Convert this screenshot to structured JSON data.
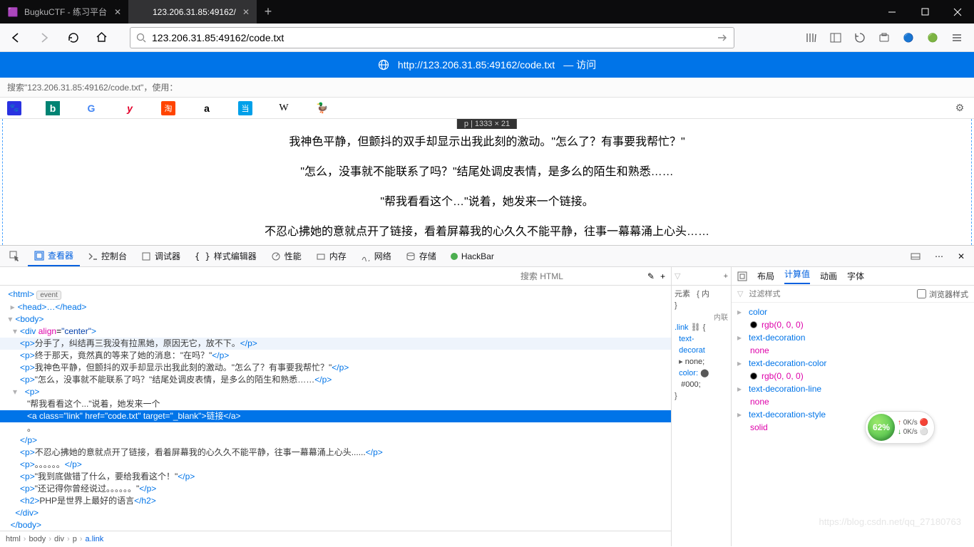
{
  "titlebar": {
    "tab1": "BugkuCTF - 练习平台",
    "tab2": "123.206.31.85:49162/"
  },
  "urlbar": {
    "value": "123.206.31.85:49162/code.txt"
  },
  "visitbar": {
    "url": "http://123.206.31.85:49162/code.txt",
    "action": "— 访问"
  },
  "searchrow": {
    "text": "搜索\"123.206.31.85:49162/code.txt\"，使用："
  },
  "engines": {
    "baidu": "百",
    "bing": "b",
    "google": "G",
    "yahoo": "y",
    "taobao": "淘",
    "amazon": "a",
    "dangdang": "当",
    "wiki": "W",
    "ddg": "●"
  },
  "content": {
    "badge": "p | 1333 × 21",
    "p1": "我神色平静，但颤抖的双手却显示出我此刻的激动。\"怎么了？有事要我帮忙？\"",
    "p2": "\"怎么，没事就不能联系了吗？\"结尾处调皮表情，是多么的陌生和熟悉……",
    "p3": "\"帮我看看这个…\"说着，她发来一个链接。",
    "p4": "不忍心拂她的意就点开了链接，看着屏幕我的心久久不能平静，往事一幕幕涌上心头……"
  },
  "devtabs": {
    "inspector": "查看器",
    "console": "控制台",
    "debugger": "调试器",
    "style": "样式编辑器",
    "perf": "性能",
    "memory": "内存",
    "network": "网络",
    "storage": "存储",
    "hackbar": "HackBar"
  },
  "htmlsearch": {
    "placeholder": "搜索 HTML"
  },
  "tree": {
    "l1": "<html>",
    "event": "event",
    "l2": "<head>…</head>",
    "l3": "<body>",
    "l4_open": "<div ",
    "l4_attr": "align",
    "l4_val": "\"center\"",
    "l4_close": ">",
    "l5_open": "<p>",
    "l5_txt": "分手了，纠结再三我没有拉黑她，原因无它，放不下。",
    "l5_close": "</p>",
    "l6_open": "<p>",
    "l6_txt": "终于那天，竟然真的等来了她的消息：\"在吗？\"",
    "l6_close": "</p>",
    "l7_open": "<p>",
    "l7_txt": "我神色平静，但颤抖的双手却显示出我此刻的激动。\"怎么了？有事要我帮忙？\"",
    "l7_close": "</p>",
    "l8_open": "<p>",
    "l8_txt": "\"怎么，没事就不能联系了吗？\"结尾处调皮表情，是多么的陌生和熟悉……",
    "l8_close": "</p>",
    "l9_open": "<p>",
    "l10_txt": "\"帮我看看这个...\"说着，她发来一个",
    "sel_open": "<a ",
    "sel_a1": "class",
    "sel_v1": "\"link\"",
    "sel_a2": "href",
    "sel_v2": "\"code.txt\"",
    "sel_a3": "target",
    "sel_v3": "\"_blank\"",
    "sel_mid": ">",
    "sel_txt": "链接",
    "sel_close": "</a>",
    "l12_txt": "。",
    "l13_close": "</p>",
    "l14_open": "<p>",
    "l14_txt": "不忍心拂她的意就点开了链接，看着屏幕我的心久久不能平静，往事一幕幕涌上心头......",
    "l14_close": "</p>",
    "l15_open": "<p>",
    "l15_txt": "。。。。。。",
    "l15_close": "</p>",
    "l16_open": "<p>",
    "l16_txt": "\"我到底做错了什么，要给我看这个！\"",
    "l16_close": "</p>",
    "l17_open": "<p>",
    "l17_txt": "\"还记得你曾经说过。。。。。。\"",
    "l17_close": "</p>",
    "l18_open": "<h2>",
    "l18_txt": "PHP是世界上最好的语言",
    "l18_close": "</h2>",
    "l19": "</div>",
    "l20": "</body>"
  },
  "rules": {
    "element": "元素",
    "inline_brace": "{",
    "inline_label": "内联",
    "link_sel": ".link",
    "link_brace": "{  ",
    "textdec": "text-",
    "textdec2": "decorat",
    "textdec_v": "none;",
    "color_k": "color:",
    "color_v": "#000;"
  },
  "computed": {
    "tabs": {
      "layout": "布局",
      "computed": "计算值",
      "anim": "动画",
      "fonts": "字体"
    },
    "filter_placeholder": "过滤样式",
    "browser_styles": "浏览器样式",
    "p_color": "color",
    "p_color_v": "rgb(0, 0, 0)",
    "p_td": "text-decoration",
    "p_td_v": "none",
    "p_tdc": "text-decoration-color",
    "p_tdc_v": "rgb(0, 0, 0)",
    "p_tdl": "text-decoration-line",
    "p_tdl_v": "none",
    "p_tds": "text-decoration-style",
    "p_tds_v": "solid"
  },
  "breadcrumb": {
    "html": "html",
    "body": "body",
    "div": "div",
    "p": "p",
    "a": "a.link"
  },
  "floater": {
    "pct": "62%",
    "up": "0K/s",
    "down": "0K/s"
  },
  "watermark": "https://blog.csdn.net/qq_27180763"
}
